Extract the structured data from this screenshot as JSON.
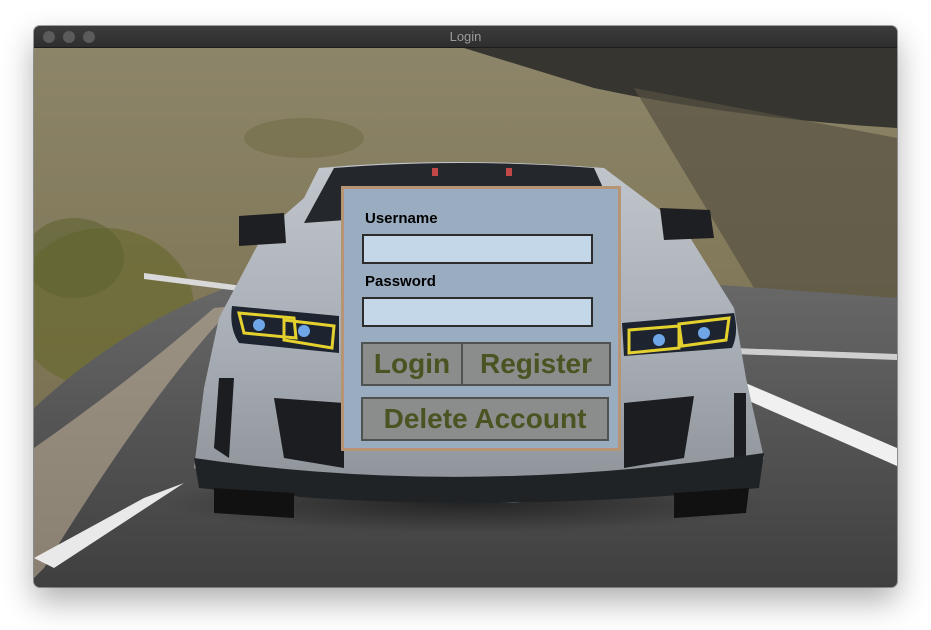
{
  "window": {
    "title": "Login",
    "controls": [
      "close-icon",
      "minimize-icon",
      "zoom-icon"
    ]
  },
  "background": {
    "image": "grey sports car photo"
  },
  "form": {
    "username_label": "Username",
    "username_value": "",
    "password_label": "Password",
    "password_value": "",
    "login_label": "Login",
    "register_label": "Register",
    "delete_label": "Delete Account"
  },
  "colors": {
    "panel": "#9aadc0",
    "panel_border": "#b69474",
    "field": "#c3d7e8",
    "button": "#8a8d8c",
    "button_text": "#4a5321"
  }
}
